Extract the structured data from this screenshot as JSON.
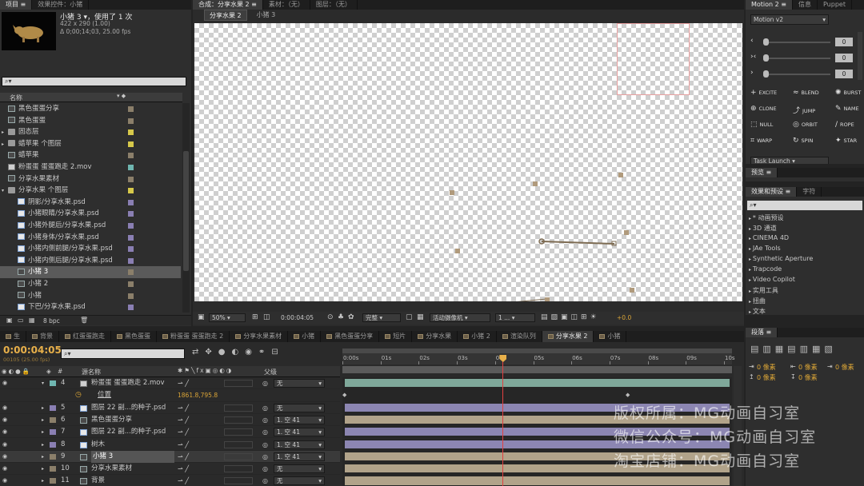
{
  "project": {
    "tabs": [
      "项目 ≡",
      "效果控件：小猪"
    ],
    "item_title": "小猪 3 ▾，使用了 1 次",
    "item_size": "422 x 290 (1.00)",
    "item_duration": "Δ 0;00;14;03, 25.00 fps",
    "search_placeholder": "⌕▾",
    "col_name": "名称",
    "items": [
      {
        "name": "黑色蛋蛋分享",
        "type": "comp",
        "indent": 0,
        "color": "#8b7f6a"
      },
      {
        "name": "黑色蛋蛋",
        "type": "comp",
        "indent": 0,
        "color": "#8b7f6a"
      },
      {
        "name": "固态层",
        "type": "folder",
        "indent": 0,
        "color": "#d6c84a"
      },
      {
        "name": "蜡苹果 个图层",
        "type": "folder",
        "indent": 0,
        "color": "#d6c84a"
      },
      {
        "name": "蜡苹果",
        "type": "comp",
        "indent": 0,
        "color": "#8b7f6a"
      },
      {
        "name": "粉蛋蛋 蛋蛋跑走 2.mov",
        "type": "file",
        "indent": 0,
        "color": "#6fb6b0"
      },
      {
        "name": "分享水果素材",
        "type": "comp",
        "indent": 0,
        "color": "#8b7f6a"
      },
      {
        "name": "分享水果 个图层",
        "type": "folder",
        "indent": 0,
        "color": "#d6c84a"
      },
      {
        "name": "阴影/分享水果.psd",
        "type": "psd",
        "indent": 1,
        "color": "#8a7fb3"
      },
      {
        "name": "小猪眼睛/分享水果.psd",
        "type": "psd",
        "indent": 1,
        "color": "#8a7fb3"
      },
      {
        "name": "小猪外腿后/分享水果.psd",
        "type": "psd",
        "indent": 1,
        "color": "#8a7fb3"
      },
      {
        "name": "小猪身体/分享水果.psd",
        "type": "psd",
        "indent": 1,
        "color": "#8a7fb3"
      },
      {
        "name": "小猪内侧前腿/分享水果.psd",
        "type": "psd",
        "indent": 1,
        "color": "#8a7fb3"
      },
      {
        "name": "小猪内侧后腿/分享水果.psd",
        "type": "psd",
        "indent": 1,
        "color": "#8a7fb3"
      },
      {
        "name": "小猪 3",
        "type": "comp",
        "indent": 1,
        "color": "#8b7f6a",
        "selected": true
      },
      {
        "name": "小猪 2",
        "type": "comp",
        "indent": 1,
        "color": "#8b7f6a"
      },
      {
        "name": "小猪",
        "type": "comp",
        "indent": 1,
        "color": "#8b7f6a"
      },
      {
        "name": "下巴/分享水果.psd",
        "type": "psd",
        "indent": 1,
        "color": "#8a7fb3"
      }
    ],
    "bpc": "8 bpc"
  },
  "composition": {
    "tabs": [
      "合成：分享水果 2 ≡",
      "素材：（无）",
      "图层：（无）"
    ],
    "subtabs": [
      "分享水果 2",
      "小猪 3"
    ],
    "zoom": "50%",
    "timecode": "0:00:04:05",
    "quality": "完整",
    "camera": "活动摄像机",
    "views": "1 ...",
    "exposure": "+0.0"
  },
  "motion": {
    "tabs": [
      "Motion 2 ≡",
      "信息",
      "Puppet"
    ],
    "select": "Motion v2",
    "slider_values": [
      "0",
      "0",
      "0"
    ],
    "buttons": [
      {
        "icon": "+",
        "label": "EXCITE"
      },
      {
        "icon": "≈",
        "label": "BLEND"
      },
      {
        "icon": "✺",
        "label": "BURST"
      },
      {
        "icon": "⊕",
        "label": "CLONE"
      },
      {
        "icon": "⤴",
        "label": "JUMP"
      },
      {
        "icon": "✎",
        "label": "NAME"
      },
      {
        "icon": "⬚",
        "label": "NULL"
      },
      {
        "icon": "◎",
        "label": "ORBIT"
      },
      {
        "icon": "∕",
        "label": "ROPE"
      },
      {
        "icon": "⌗",
        "label": "WARP"
      },
      {
        "icon": "↻",
        "label": "SPIN"
      },
      {
        "icon": "✦",
        "label": "STAR"
      }
    ],
    "task": "Task Launch"
  },
  "preview": {
    "tab": "预览 ≡"
  },
  "effects": {
    "tabs": [
      "效果和预设 ≡",
      "字符"
    ],
    "search": "⌕▾",
    "items": [
      "* 动画预设",
      "3D 通道",
      "CINEMA 4D",
      "JAe Tools",
      "Synthetic Aperture",
      "Trapcode",
      "Video Copilot",
      "实用工具",
      "扭曲",
      "文本"
    ]
  },
  "paragraph": {
    "tab": "段落 ≡",
    "fields": [
      "0 像素",
      "0 像素",
      "0 像素",
      "0 像素",
      "0 像素"
    ]
  },
  "timeline": {
    "tabs": [
      "生",
      "背景",
      "红蛋蛋跑走",
      "黑色蛋蛋",
      "粉蛋蛋 蛋蛋跑走 2",
      "分享水果素材",
      "小猪",
      "黑色蛋蛋分享",
      "短片",
      "分享水果",
      "小猪 2",
      "渲染队列",
      "分享水果 2",
      "小猪"
    ],
    "active_tab": "分享水果 2",
    "timecode": "0:00:04:05",
    "frame_info": "00105 (25.00 fps)",
    "col_source": "源名称",
    "col_parent": "父级",
    "ticks": [
      "0:00s",
      "01s",
      "02s",
      "03s",
      "04s",
      "05s",
      "06s",
      "07s",
      "08s",
      "09s",
      "10s"
    ],
    "current_time": 4.2,
    "duration": 10,
    "layers": [
      {
        "num": "4",
        "name": "粉蛋蛋 蛋蛋跑走 2.mov",
        "label": "#6fb6b0",
        "parent": "无",
        "bar": "#7fa89a",
        "selected": false,
        "icon": "file"
      },
      {
        "num": "",
        "name": "位置",
        "label": "",
        "parent": "",
        "bar": "",
        "sub": true,
        "value": "1861.8,795.8"
      },
      {
        "num": "5",
        "name": "图层 22 副...的种子.psd",
        "label": "#8a7fb3",
        "parent": "无",
        "bar": "#8c86b2",
        "icon": "psd"
      },
      {
        "num": "6",
        "name": "黑色蛋蛋分享",
        "label": "#8b7f6a",
        "parent": "1. 空 41",
        "bar": "#b1a38a",
        "icon": "comp"
      },
      {
        "num": "7",
        "name": "图层 22 副...的种子.psd",
        "label": "#8a7fb3",
        "parent": "1. 空 41",
        "bar": "#8c86b2",
        "icon": "psd"
      },
      {
        "num": "8",
        "name": "树木",
        "label": "#8a7fb3",
        "parent": "1. 空 41",
        "bar": "#8c86b2",
        "icon": "psd"
      },
      {
        "num": "9",
        "name": "小猪 3",
        "label": "#8b7f6a",
        "parent": "1. 空 41",
        "bar": "#b1a38a",
        "selected": true,
        "icon": "comp"
      },
      {
        "num": "10",
        "name": "分享水果素材",
        "label": "#8b7f6a",
        "parent": "无",
        "bar": "#b1a38a",
        "icon": "comp"
      },
      {
        "num": "11",
        "name": "背景",
        "label": "#8b7f6a",
        "parent": "无",
        "bar": "#b1a38a",
        "icon": "comp"
      }
    ]
  },
  "watermark": [
    "版权所属：MG动画自习室",
    "微信公众号：MG动画自习室",
    "淘宝店铺：MG动画自习室"
  ]
}
